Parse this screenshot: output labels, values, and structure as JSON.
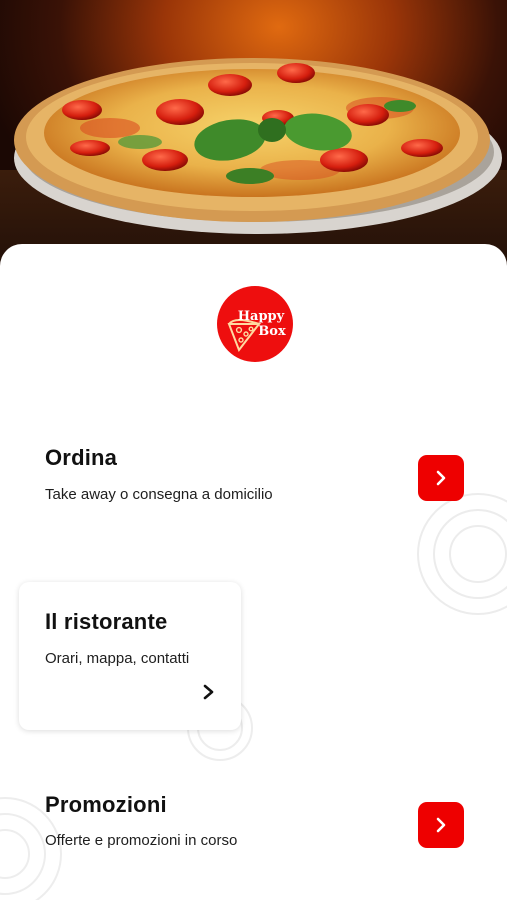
{
  "brand": {
    "logo_line1": "Happy",
    "logo_line2": "Box",
    "color_primary": "#ee0000"
  },
  "hero": {
    "image": "pizza-margherita-photo"
  },
  "sections": {
    "ordina": {
      "title": "Ordina",
      "subtitle": "Take away o consegna a domicilio",
      "icon": "chevron-right-icon"
    },
    "ristorante": {
      "title": "Il ristorante",
      "subtitle": "Orari, mappa, contatti",
      "icon": "chevron-right-icon"
    },
    "promozioni": {
      "title": "Promozioni",
      "subtitle": "Offerte e promozioni in corso",
      "icon": "chevron-right-icon"
    }
  }
}
